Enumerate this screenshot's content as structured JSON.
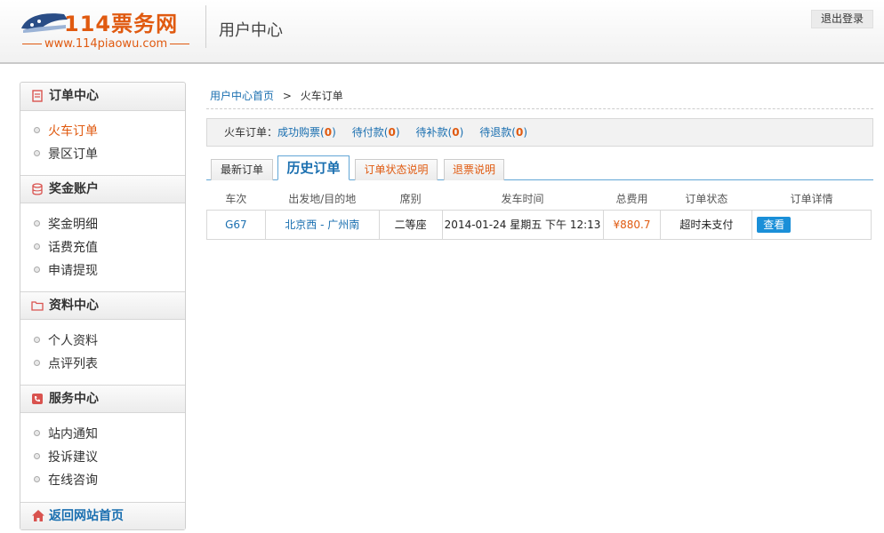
{
  "header": {
    "logo_text": "114票务网",
    "logo_url": "www.114piaowu.com",
    "title": "用户中心",
    "logout_label": "退出登录"
  },
  "sidebar": {
    "sections": [
      {
        "title": "订单中心",
        "icon": "order-icon",
        "items": [
          "火车订单",
          "景区订单"
        ]
      },
      {
        "title": "奖金账户",
        "icon": "coins-icon",
        "items": [
          "奖金明细",
          "话费充值",
          "申请提现"
        ]
      },
      {
        "title": "资料中心",
        "icon": "folder-icon",
        "items": [
          "个人资料",
          "点评列表"
        ]
      },
      {
        "title": "服务中心",
        "icon": "service-icon",
        "items": [
          "站内通知",
          "投诉建议",
          "在线咨询"
        ]
      }
    ],
    "active_item": "火车订单",
    "footer": {
      "label": "返回网站首页",
      "icon": "home-icon"
    }
  },
  "breadcrumb": {
    "home": "用户中心首页",
    "separator": ">",
    "current": "火车订单"
  },
  "summary": {
    "label": "火车订单：",
    "links": [
      {
        "label": "成功购票",
        "count": "0"
      },
      {
        "label": "待付款",
        "count": "0"
      },
      {
        "label": "待补款",
        "count": "0"
      },
      {
        "label": "待退款",
        "count": "0"
      }
    ]
  },
  "tabs": [
    "最新订单",
    "历史订单",
    "订单状态说明",
    "退票说明"
  ],
  "active_tab": "历史订单",
  "table": {
    "columns": [
      "车次",
      "出发地/目的地",
      "席别",
      "发车时间",
      "总费用",
      "订单状态",
      "订单详情"
    ],
    "rows": [
      {
        "train": "G67",
        "route": "北京西 - 广州南",
        "seat": "二等座",
        "departure": "2014-01-24 星期五 下午 12:13",
        "price": "¥880.7",
        "status": "超时未支付",
        "action": "查看"
      }
    ]
  },
  "colors": {
    "accent_orange": "#e05a10",
    "link_blue": "#1a6fb0",
    "button_blue": "#1a8fd8"
  }
}
